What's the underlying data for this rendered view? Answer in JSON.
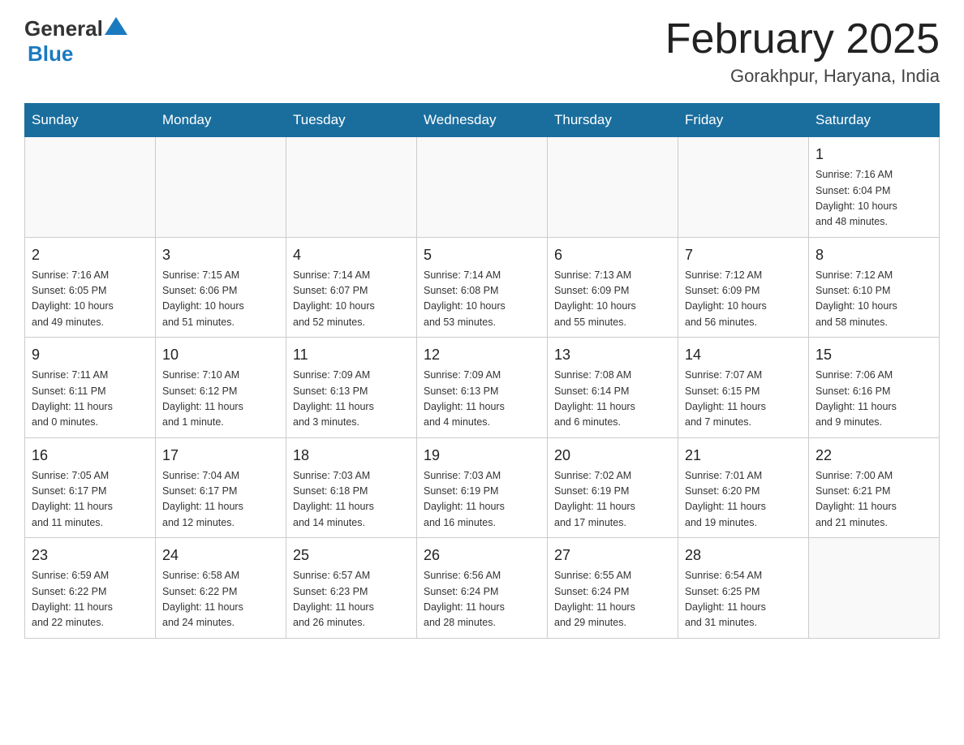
{
  "header": {
    "logo_general": "General",
    "logo_blue": "Blue",
    "title": "February 2025",
    "subtitle": "Gorakhpur, Haryana, India"
  },
  "days_of_week": [
    "Sunday",
    "Monday",
    "Tuesday",
    "Wednesday",
    "Thursday",
    "Friday",
    "Saturday"
  ],
  "weeks": [
    {
      "days": [
        {
          "number": "",
          "info": ""
        },
        {
          "number": "",
          "info": ""
        },
        {
          "number": "",
          "info": ""
        },
        {
          "number": "",
          "info": ""
        },
        {
          "number": "",
          "info": ""
        },
        {
          "number": "",
          "info": ""
        },
        {
          "number": "1",
          "info": "Sunrise: 7:16 AM\nSunset: 6:04 PM\nDaylight: 10 hours\nand 48 minutes."
        }
      ]
    },
    {
      "days": [
        {
          "number": "2",
          "info": "Sunrise: 7:16 AM\nSunset: 6:05 PM\nDaylight: 10 hours\nand 49 minutes."
        },
        {
          "number": "3",
          "info": "Sunrise: 7:15 AM\nSunset: 6:06 PM\nDaylight: 10 hours\nand 51 minutes."
        },
        {
          "number": "4",
          "info": "Sunrise: 7:14 AM\nSunset: 6:07 PM\nDaylight: 10 hours\nand 52 minutes."
        },
        {
          "number": "5",
          "info": "Sunrise: 7:14 AM\nSunset: 6:08 PM\nDaylight: 10 hours\nand 53 minutes."
        },
        {
          "number": "6",
          "info": "Sunrise: 7:13 AM\nSunset: 6:09 PM\nDaylight: 10 hours\nand 55 minutes."
        },
        {
          "number": "7",
          "info": "Sunrise: 7:12 AM\nSunset: 6:09 PM\nDaylight: 10 hours\nand 56 minutes."
        },
        {
          "number": "8",
          "info": "Sunrise: 7:12 AM\nSunset: 6:10 PM\nDaylight: 10 hours\nand 58 minutes."
        }
      ]
    },
    {
      "days": [
        {
          "number": "9",
          "info": "Sunrise: 7:11 AM\nSunset: 6:11 PM\nDaylight: 11 hours\nand 0 minutes."
        },
        {
          "number": "10",
          "info": "Sunrise: 7:10 AM\nSunset: 6:12 PM\nDaylight: 11 hours\nand 1 minute."
        },
        {
          "number": "11",
          "info": "Sunrise: 7:09 AM\nSunset: 6:13 PM\nDaylight: 11 hours\nand 3 minutes."
        },
        {
          "number": "12",
          "info": "Sunrise: 7:09 AM\nSunset: 6:13 PM\nDaylight: 11 hours\nand 4 minutes."
        },
        {
          "number": "13",
          "info": "Sunrise: 7:08 AM\nSunset: 6:14 PM\nDaylight: 11 hours\nand 6 minutes."
        },
        {
          "number": "14",
          "info": "Sunrise: 7:07 AM\nSunset: 6:15 PM\nDaylight: 11 hours\nand 7 minutes."
        },
        {
          "number": "15",
          "info": "Sunrise: 7:06 AM\nSunset: 6:16 PM\nDaylight: 11 hours\nand 9 minutes."
        }
      ]
    },
    {
      "days": [
        {
          "number": "16",
          "info": "Sunrise: 7:05 AM\nSunset: 6:17 PM\nDaylight: 11 hours\nand 11 minutes."
        },
        {
          "number": "17",
          "info": "Sunrise: 7:04 AM\nSunset: 6:17 PM\nDaylight: 11 hours\nand 12 minutes."
        },
        {
          "number": "18",
          "info": "Sunrise: 7:03 AM\nSunset: 6:18 PM\nDaylight: 11 hours\nand 14 minutes."
        },
        {
          "number": "19",
          "info": "Sunrise: 7:03 AM\nSunset: 6:19 PM\nDaylight: 11 hours\nand 16 minutes."
        },
        {
          "number": "20",
          "info": "Sunrise: 7:02 AM\nSunset: 6:19 PM\nDaylight: 11 hours\nand 17 minutes."
        },
        {
          "number": "21",
          "info": "Sunrise: 7:01 AM\nSunset: 6:20 PM\nDaylight: 11 hours\nand 19 minutes."
        },
        {
          "number": "22",
          "info": "Sunrise: 7:00 AM\nSunset: 6:21 PM\nDaylight: 11 hours\nand 21 minutes."
        }
      ]
    },
    {
      "days": [
        {
          "number": "23",
          "info": "Sunrise: 6:59 AM\nSunset: 6:22 PM\nDaylight: 11 hours\nand 22 minutes."
        },
        {
          "number": "24",
          "info": "Sunrise: 6:58 AM\nSunset: 6:22 PM\nDaylight: 11 hours\nand 24 minutes."
        },
        {
          "number": "25",
          "info": "Sunrise: 6:57 AM\nSunset: 6:23 PM\nDaylight: 11 hours\nand 26 minutes."
        },
        {
          "number": "26",
          "info": "Sunrise: 6:56 AM\nSunset: 6:24 PM\nDaylight: 11 hours\nand 28 minutes."
        },
        {
          "number": "27",
          "info": "Sunrise: 6:55 AM\nSunset: 6:24 PM\nDaylight: 11 hours\nand 29 minutes."
        },
        {
          "number": "28",
          "info": "Sunrise: 6:54 AM\nSunset: 6:25 PM\nDaylight: 11 hours\nand 31 minutes."
        },
        {
          "number": "",
          "info": ""
        }
      ]
    }
  ]
}
